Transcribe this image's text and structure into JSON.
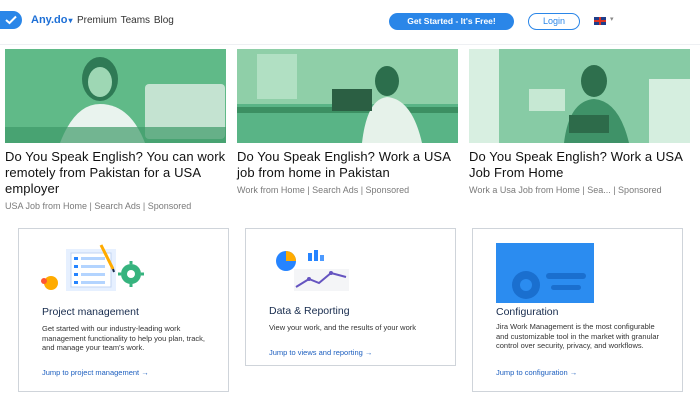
{
  "nav": {
    "brand": "Any.do",
    "links": "Premium Teams Blog",
    "cta": "Get Started - It's Free!",
    "login": "Login",
    "lang_icon": "uk-flag-icon"
  },
  "ads": [
    {
      "headline": "Do You Speak English? You can work remotely from Pakistan for a USA employer",
      "meta": "USA Job from Home | Search Ads | Sponsored"
    },
    {
      "headline": "Do You Speak English? Work a USA job from home in Pakistan",
      "meta": "Work from Home | Search Ads | Sponsored"
    },
    {
      "headline": "Do You Speak English? Work a USA Job From Home",
      "meta": "Work a Usa Job from Home | Sea... | Sponsored"
    }
  ],
  "features": [
    {
      "title": "Project management",
      "desc": "Get started with our industry-leading work management functionality to help you plan, track, and manage your team's work.",
      "link": "Jump to project management →",
      "icon": "project-illustration-icon"
    },
    {
      "title": "Data & Reporting",
      "desc": "View your work, and the results of your work",
      "link": "Jump to views and reporting →",
      "icon": "reporting-illustration-icon"
    },
    {
      "title": "Configuration",
      "desc": "Jira Work Management is the most configurable and customizable tool in the market with granular control over security, privacy, and workflows.",
      "link": "Jump to configuration →",
      "icon": "configuration-illustration-icon"
    }
  ],
  "colors": {
    "accent": "#2a86e8",
    "image_tint": "#3aa36b",
    "link": "#1d5fbf"
  }
}
